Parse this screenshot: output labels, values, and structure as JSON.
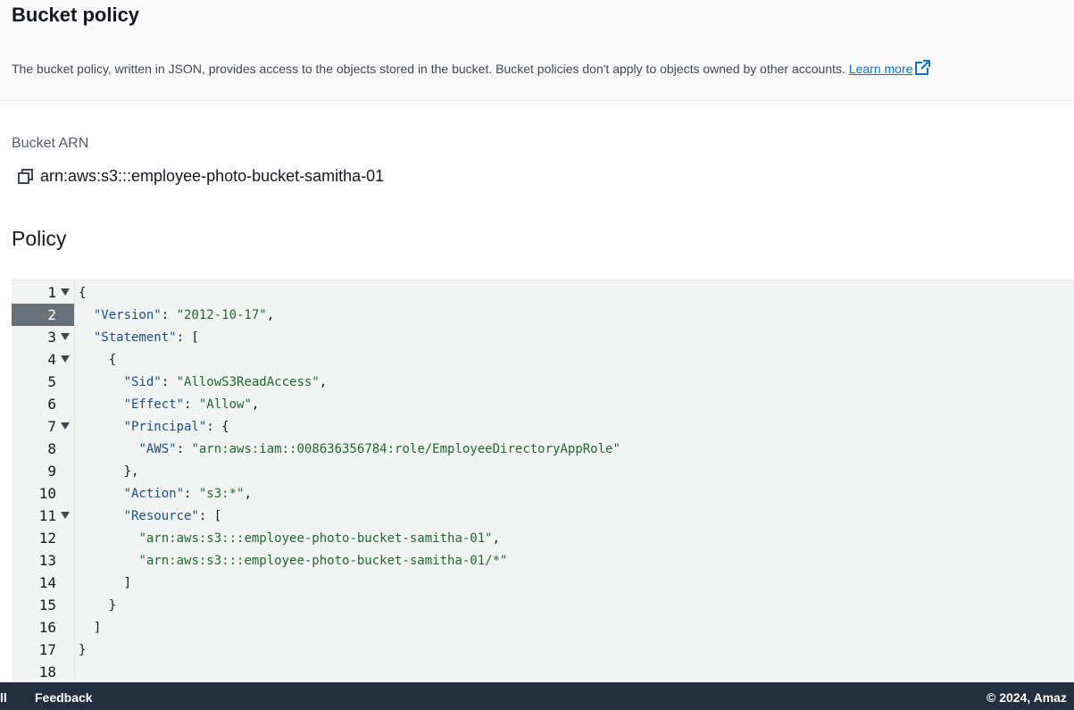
{
  "header": {
    "title": "Bucket policy",
    "description": "The bucket policy, written in JSON, provides access to the objects stored in the bucket. Bucket policies don't apply to objects owned by other accounts.",
    "learn_more": "Learn more",
    "external_icon": "external-link-icon"
  },
  "arn": {
    "label": "Bucket ARN",
    "value": "arn:aws:s3:::employee-photo-bucket-samitha-01",
    "copy_icon": "copy-icon"
  },
  "policy": {
    "heading": "Policy",
    "active_line": 2,
    "lines": [
      {
        "num": "1",
        "fold": true,
        "code": [
          {
            "t": "p",
            "v": "{"
          }
        ]
      },
      {
        "num": "2",
        "fold": false,
        "code": [
          {
            "t": "p",
            "v": "  "
          },
          {
            "t": "k",
            "v": "\"Version\""
          },
          {
            "t": "p",
            "v": ": "
          },
          {
            "t": "s",
            "v": "\"2012-10-17\""
          },
          {
            "t": "p",
            "v": ","
          }
        ]
      },
      {
        "num": "3",
        "fold": true,
        "code": [
          {
            "t": "p",
            "v": "  "
          },
          {
            "t": "k",
            "v": "\"Statement\""
          },
          {
            "t": "p",
            "v": ": ["
          }
        ]
      },
      {
        "num": "4",
        "fold": true,
        "code": [
          {
            "t": "p",
            "v": "    {"
          }
        ]
      },
      {
        "num": "5",
        "fold": false,
        "code": [
          {
            "t": "p",
            "v": "      "
          },
          {
            "t": "k",
            "v": "\"Sid\""
          },
          {
            "t": "p",
            "v": ": "
          },
          {
            "t": "s",
            "v": "\"AllowS3ReadAccess\""
          },
          {
            "t": "p",
            "v": ","
          }
        ]
      },
      {
        "num": "6",
        "fold": false,
        "code": [
          {
            "t": "p",
            "v": "      "
          },
          {
            "t": "k",
            "v": "\"Effect\""
          },
          {
            "t": "p",
            "v": ": "
          },
          {
            "t": "s",
            "v": "\"Allow\""
          },
          {
            "t": "p",
            "v": ","
          }
        ]
      },
      {
        "num": "7",
        "fold": true,
        "code": [
          {
            "t": "p",
            "v": "      "
          },
          {
            "t": "k",
            "v": "\"Principal\""
          },
          {
            "t": "p",
            "v": ": {"
          }
        ]
      },
      {
        "num": "8",
        "fold": false,
        "code": [
          {
            "t": "p",
            "v": "        "
          },
          {
            "t": "k",
            "v": "\"AWS\""
          },
          {
            "t": "p",
            "v": ": "
          },
          {
            "t": "s",
            "v": "\"arn:aws:iam::008636356784:role/EmployeeDirectoryAppRole\""
          }
        ]
      },
      {
        "num": "9",
        "fold": false,
        "code": [
          {
            "t": "p",
            "v": "      },"
          }
        ]
      },
      {
        "num": "10",
        "fold": false,
        "code": [
          {
            "t": "p",
            "v": "      "
          },
          {
            "t": "k",
            "v": "\"Action\""
          },
          {
            "t": "p",
            "v": ": "
          },
          {
            "t": "s",
            "v": "\"s3:*\""
          },
          {
            "t": "p",
            "v": ","
          }
        ]
      },
      {
        "num": "11",
        "fold": true,
        "code": [
          {
            "t": "p",
            "v": "      "
          },
          {
            "t": "k",
            "v": "\"Resource\""
          },
          {
            "t": "p",
            "v": ": ["
          }
        ]
      },
      {
        "num": "12",
        "fold": false,
        "code": [
          {
            "t": "p",
            "v": "        "
          },
          {
            "t": "s",
            "v": "\"arn:aws:s3:::employee-photo-bucket-samitha-01\""
          },
          {
            "t": "p",
            "v": ","
          }
        ]
      },
      {
        "num": "13",
        "fold": false,
        "code": [
          {
            "t": "p",
            "v": "        "
          },
          {
            "t": "s",
            "v": "\"arn:aws:s3:::employee-photo-bucket-samitha-01/*\""
          }
        ]
      },
      {
        "num": "14",
        "fold": false,
        "code": [
          {
            "t": "p",
            "v": "      ]"
          }
        ]
      },
      {
        "num": "15",
        "fold": false,
        "code": [
          {
            "t": "p",
            "v": "    }"
          }
        ]
      },
      {
        "num": "16",
        "fold": false,
        "code": [
          {
            "t": "p",
            "v": "  ]"
          }
        ]
      },
      {
        "num": "17",
        "fold": false,
        "code": [
          {
            "t": "p",
            "v": "}"
          }
        ]
      },
      {
        "num": "18",
        "fold": false,
        "code": []
      }
    ]
  },
  "footer": {
    "left_cut": "ll",
    "feedback": "Feedback",
    "copyright": "© 2024, Amaz"
  }
}
